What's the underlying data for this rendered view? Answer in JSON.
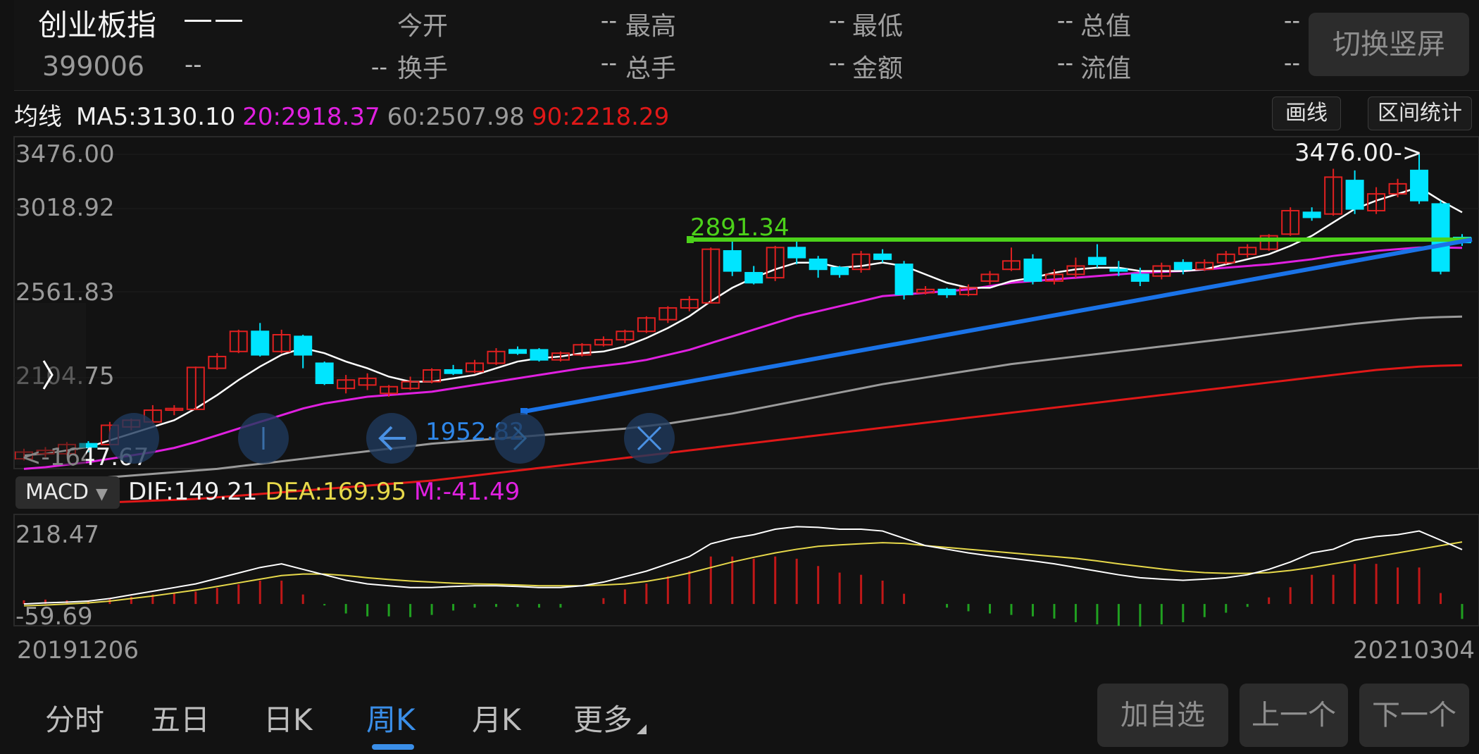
{
  "header": {
    "name": "创业板指",
    "name_value": "——",
    "code": "399006",
    "code_value": "--",
    "code_value2": "--",
    "quotes": [
      {
        "label": "今开",
        "value": "--"
      },
      {
        "label": "最高",
        "value": "--"
      },
      {
        "label": "最低",
        "value": "--"
      },
      {
        "label": "总值",
        "value": "--"
      },
      {
        "label": "换手",
        "value": "--"
      },
      {
        "label": "总手",
        "value": "--"
      },
      {
        "label": "金额",
        "value": "--"
      },
      {
        "label": "流值",
        "value": "--"
      }
    ],
    "switch_label": "切换竖屏"
  },
  "ma_bar": {
    "title": "均线",
    "ma5": "MA5:3130.10",
    "ma20": "20:2918.37",
    "ma60": "60:2507.98",
    "ma90": "90:2218.29",
    "draw_label": "画线",
    "stats_label": "区间统计"
  },
  "colors": {
    "up": "#e02020",
    "down": "#00e5ff",
    "ma5": "#ffffff",
    "ma20": "#e020e0",
    "ma60": "#9a9a9a",
    "ma90": "#e01818",
    "support_line": "#1a73e8",
    "resistance_line": "#4cd21a",
    "dif": "#ffffff",
    "dea": "#e6d84a",
    "bar_up": "#c01818",
    "bar_down": "#20a020",
    "accent": "#3a8ee8"
  },
  "chart_data": {
    "type": "candlestick",
    "ylim": [
      1647.67,
      3476.0
    ],
    "y_ticks": [
      "3476.00",
      "3018.92",
      "2561.83",
      "2104.75",
      "1647.67"
    ],
    "x_start": "20191206",
    "x_end": "20210304",
    "max_marker": "3476.00->",
    "min_marker": "<-1647.67",
    "resistance_label": "2891.34",
    "support_label": "1952.82",
    "candles": [
      [
        1660,
        1700,
        1720,
        1650
      ],
      [
        1690,
        1710,
        1730,
        1670
      ],
      [
        1690,
        1745,
        1760,
        1680
      ],
      [
        1750,
        1730,
        1765,
        1700
      ],
      [
        1745,
        1860,
        1880,
        1740
      ],
      [
        1850,
        1890,
        1900,
        1830
      ],
      [
        1880,
        1950,
        1980,
        1870
      ],
      [
        1950,
        1960,
        1980,
        1920
      ],
      [
        1955,
        2205,
        2210,
        1950
      ],
      [
        2200,
        2270,
        2290,
        2190
      ],
      [
        2300,
        2420,
        2430,
        2290
      ],
      [
        2420,
        2280,
        2470,
        2270
      ],
      [
        2300,
        2400,
        2430,
        2290
      ],
      [
        2390,
        2280,
        2400,
        2200
      ],
      [
        2230,
        2110,
        2240,
        2100
      ],
      [
        2080,
        2130,
        2160,
        2050
      ],
      [
        2100,
        2140,
        2170,
        2070
      ],
      [
        2050,
        2090,
        2100,
        2030
      ],
      [
        2080,
        2120,
        2150,
        2070
      ],
      [
        2120,
        2190,
        2200,
        2110
      ],
      [
        2190,
        2170,
        2220,
        2160
      ],
      [
        2180,
        2230,
        2250,
        2170
      ],
      [
        2230,
        2300,
        2320,
        2220
      ],
      [
        2310,
        2290,
        2330,
        2280
      ],
      [
        2310,
        2250,
        2320,
        2240
      ],
      [
        2250,
        2290,
        2300,
        2240
      ],
      [
        2280,
        2340,
        2350,
        2270
      ],
      [
        2340,
        2370,
        2390,
        2330
      ],
      [
        2370,
        2420,
        2430,
        2350
      ],
      [
        2420,
        2500,
        2510,
        2410
      ],
      [
        2490,
        2560,
        2570,
        2470
      ],
      [
        2560,
        2610,
        2630,
        2540
      ],
      [
        2590,
        2910,
        2920,
        2590
      ],
      [
        2900,
        2780,
        2980,
        2750
      ],
      [
        2770,
        2710,
        2810,
        2700
      ],
      [
        2740,
        2920,
        2930,
        2720
      ],
      [
        2920,
        2860,
        2980,
        2820
      ],
      [
        2850,
        2790,
        2870,
        2740
      ],
      [
        2800,
        2760,
        2810,
        2740
      ],
      [
        2790,
        2880,
        2900,
        2770
      ],
      [
        2880,
        2850,
        2910,
        2830
      ],
      [
        2820,
        2640,
        2840,
        2610
      ],
      [
        2650,
        2670,
        2690,
        2640
      ],
      [
        2670,
        2640,
        2680,
        2620
      ],
      [
        2640,
        2680,
        2700,
        2630
      ],
      [
        2720,
        2760,
        2780,
        2700
      ],
      [
        2790,
        2840,
        2920,
        2780
      ],
      [
        2850,
        2720,
        2880,
        2700
      ],
      [
        2720,
        2760,
        2790,
        2700
      ],
      [
        2760,
        2810,
        2860,
        2740
      ],
      [
        2860,
        2820,
        2940,
        2800
      ],
      [
        2790,
        2780,
        2840,
        2750
      ],
      [
        2760,
        2720,
        2800,
        2690
      ],
      [
        2750,
        2810,
        2830,
        2730
      ],
      [
        2830,
        2790,
        2850,
        2760
      ],
      [
        2790,
        2830,
        2850,
        2780
      ],
      [
        2830,
        2880,
        2900,
        2820
      ],
      [
        2880,
        2920,
        2940,
        2860
      ],
      [
        2910,
        2990,
        3000,
        2900
      ],
      [
        3000,
        3140,
        3160,
        2990
      ],
      [
        3130,
        3100,
        3160,
        3080
      ],
      [
        3120,
        3340,
        3390,
        3110
      ],
      [
        3320,
        3150,
        3380,
        3120
      ],
      [
        3140,
        3240,
        3280,
        3120
      ],
      [
        3240,
        3300,
        3330,
        3220
      ],
      [
        3380,
        3200,
        3476,
        3180
      ],
      [
        3180,
        2780,
        3200,
        2760
      ],
      [
        2980,
        2950,
        3000,
        2930
      ]
    ],
    "ma5": [
      1680,
      1690,
      1710,
      1730,
      1770,
      1810,
      1850,
      1890,
      1960,
      2040,
      2130,
      2210,
      2280,
      2320,
      2290,
      2240,
      2200,
      2150,
      2120,
      2120,
      2140,
      2160,
      2200,
      2240,
      2260,
      2270,
      2290,
      2300,
      2330,
      2380,
      2440,
      2510,
      2600,
      2680,
      2740,
      2790,
      2830,
      2830,
      2800,
      2810,
      2830,
      2810,
      2760,
      2710,
      2680,
      2680,
      2720,
      2740,
      2770,
      2790,
      2800,
      2800,
      2780,
      2780,
      2780,
      2790,
      2820,
      2850,
      2880,
      2930,
      2990,
      3070,
      3150,
      3200,
      3240,
      3280,
      3200,
      3130
    ],
    "ma20": [
      1600,
      1610,
      1625,
      1640,
      1660,
      1680,
      1700,
      1725,
      1760,
      1800,
      1840,
      1880,
      1920,
      1960,
      1990,
      2010,
      2030,
      2040,
      2050,
      2060,
      2080,
      2100,
      2120,
      2140,
      2160,
      2180,
      2200,
      2215,
      2230,
      2250,
      2280,
      2310,
      2350,
      2390,
      2430,
      2470,
      2510,
      2540,
      2570,
      2600,
      2630,
      2640,
      2650,
      2660,
      2670,
      2690,
      2710,
      2720,
      2730,
      2740,
      2750,
      2760,
      2770,
      2775,
      2780,
      2790,
      2800,
      2810,
      2820,
      2835,
      2850,
      2870,
      2885,
      2900,
      2910,
      2920,
      2920,
      2918
    ],
    "ma60": [
      1520,
      1525,
      1530,
      1540,
      1550,
      1560,
      1570,
      1580,
      1590,
      1600,
      1615,
      1630,
      1645,
      1660,
      1675,
      1690,
      1705,
      1720,
      1735,
      1750,
      1760,
      1770,
      1780,
      1790,
      1800,
      1810,
      1820,
      1830,
      1840,
      1855,
      1870,
      1890,
      1910,
      1930,
      1955,
      1980,
      2005,
      2030,
      2055,
      2080,
      2105,
      2125,
      2145,
      2165,
      2185,
      2205,
      2225,
      2240,
      2255,
      2270,
      2285,
      2300,
      2315,
      2330,
      2345,
      2360,
      2375,
      2390,
      2405,
      2420,
      2435,
      2450,
      2465,
      2478,
      2490,
      2500,
      2505,
      2508
    ],
    "ma90": [
      1380,
      1385,
      1390,
      1395,
      1400,
      1405,
      1410,
      1415,
      1420,
      1430,
      1440,
      1450,
      1460,
      1470,
      1480,
      1490,
      1500,
      1510,
      1520,
      1530,
      1545,
      1560,
      1575,
      1590,
      1605,
      1620,
      1635,
      1650,
      1665,
      1680,
      1695,
      1710,
      1725,
      1740,
      1755,
      1770,
      1785,
      1800,
      1815,
      1830,
      1845,
      1860,
      1875,
      1890,
      1905,
      1920,
      1935,
      1950,
      1965,
      1980,
      1995,
      2010,
      2025,
      2040,
      2055,
      2070,
      2085,
      2100,
      2115,
      2130,
      2145,
      2160,
      2175,
      2190,
      2200,
      2210,
      2215,
      2218
    ],
    "macd": {
      "label": "MACD",
      "dif_label": "DIF:149.21",
      "dea_label": "DEA:169.95",
      "m_label": "M:-41.49",
      "ylim": [
        -59.69,
        218.47
      ],
      "y_ticks": [
        "218.47",
        "-59.69"
      ],
      "dif": [
        0,
        3,
        5,
        8,
        15,
        25,
        35,
        45,
        55,
        70,
        85,
        100,
        110,
        95,
        80,
        65,
        55,
        50,
        45,
        45,
        48,
        50,
        50,
        48,
        45,
        45,
        50,
        60,
        75,
        90,
        110,
        130,
        165,
        180,
        190,
        205,
        212,
        210,
        205,
        205,
        200,
        180,
        160,
        150,
        140,
        132,
        125,
        118,
        110,
        100,
        90,
        80,
        72,
        68,
        65,
        68,
        72,
        80,
        95,
        115,
        140,
        150,
        175,
        185,
        190,
        200,
        175,
        149
      ],
      "dea": [
        -5,
        -3,
        0,
        3,
        8,
        15,
        22,
        30,
        38,
        48,
        58,
        68,
        78,
        82,
        82,
        78,
        72,
        67,
        63,
        60,
        57,
        55,
        54,
        52,
        50,
        50,
        50,
        52,
        55,
        62,
        72,
        85,
        100,
        115,
        128,
        140,
        150,
        158,
        162,
        165,
        168,
        166,
        160,
        155,
        150,
        145,
        140,
        135,
        130,
        125,
        118,
        110,
        103,
        96,
        90,
        86,
        84,
        84,
        86,
        92,
        100,
        110,
        120,
        130,
        140,
        150,
        160,
        170
      ],
      "m": [
        10,
        12,
        10,
        10,
        14,
        20,
        26,
        30,
        34,
        44,
        54,
        64,
        64,
        26,
        -4,
        -26,
        -34,
        -34,
        -36,
        -30,
        -18,
        -10,
        -8,
        -8,
        -10,
        -10,
        0,
        16,
        40,
        56,
        76,
        90,
        130,
        130,
        124,
        130,
        124,
        104,
        86,
        80,
        64,
        28,
        0,
        -10,
        -20,
        -26,
        -30,
        -34,
        -40,
        -50,
        -56,
        -60,
        -62,
        -56,
        -50,
        -36,
        -24,
        -8,
        18,
        46,
        80,
        80,
        110,
        110,
        100,
        100,
        30,
        -41
      ]
    }
  },
  "dates": {
    "start": "20191206",
    "end": "20210304"
  },
  "tabs": [
    {
      "label": "分时",
      "active": false
    },
    {
      "label": "五日",
      "active": false
    },
    {
      "label": "日K",
      "active": false
    },
    {
      "label": "周K",
      "active": true
    },
    {
      "label": "月K",
      "active": false
    },
    {
      "label": "更多",
      "active": false
    }
  ],
  "actions": {
    "add_watch": "加自选",
    "prev": "上一个",
    "next": "下一个"
  },
  "icons": [
    "chevron-right-icon",
    "arrow-left-icon",
    "plus-icon",
    "chevron-right-icon",
    "collapse-icon"
  ]
}
